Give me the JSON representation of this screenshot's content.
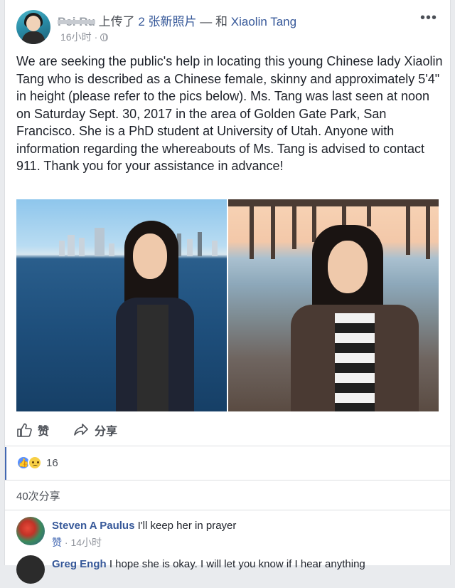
{
  "post": {
    "poster_name": "Pei Ru",
    "action_text": "上传了",
    "photo_count_text": "2 张新照片",
    "with_text": "— 和",
    "tagged_name": "Xiaolin Tang",
    "timestamp": "16小时",
    "more_label": "•••",
    "body": "We are seeking the public's help in locating this young Chinese lady Xiaolin Tang who is described as a Chinese female, skinny and approximately 5'4\" in height (please refer to the pics below). Ms. Tang was last seen at noon on Saturday Sept. 30, 2017 in the area of Golden Gate Park, San Francisco. She is a PhD student at University of Utah. Anyone with information regarding the whereabouts of Ms. Tang is advised to contact 911. Thank you for your assistance in advance!"
  },
  "actions": {
    "like_label": "赞",
    "share_label": "分享"
  },
  "reactions": {
    "count": "16",
    "types": [
      "like-icon",
      "sad-icon"
    ]
  },
  "shares": {
    "label": "40次分享"
  },
  "comments": [
    {
      "name": "Steven A Paulus",
      "text": "I'll keep her in prayer",
      "like_label": "赞",
      "time": "14小时"
    },
    {
      "name": "Greg Engh",
      "text": "I hope she is okay. I will let you know if I hear anything"
    }
  ],
  "colors": {
    "link": "#365899",
    "accent": "#4267b2",
    "like_bubble": "#5890ff",
    "sad_bubble": "#f7cf45"
  }
}
